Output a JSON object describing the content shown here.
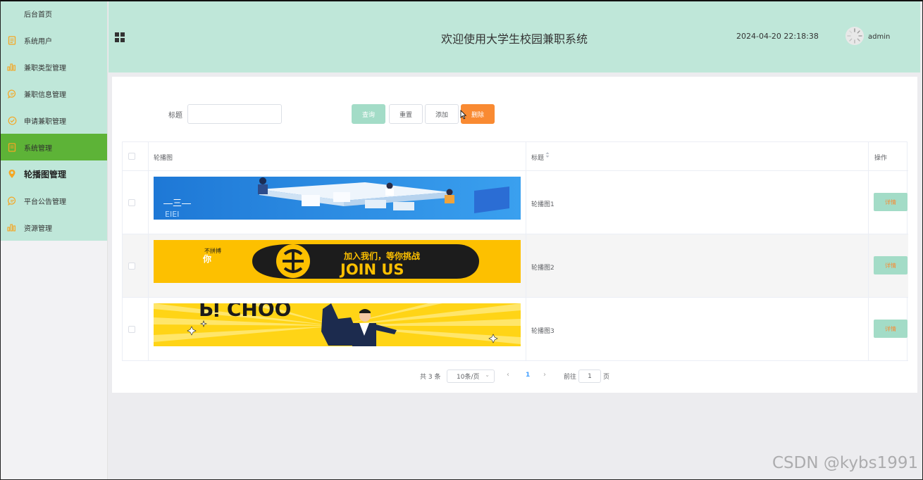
{
  "sidebar": {
    "items": [
      {
        "label": "后台首页",
        "icon": "none"
      },
      {
        "label": "系统用户",
        "icon": "document-icon"
      },
      {
        "label": "兼职类型管理",
        "icon": "bar-chart-icon"
      },
      {
        "label": "兼职信息管理",
        "icon": "chat-bubble-icon"
      },
      {
        "label": "申请兼职管理",
        "icon": "check-circle-icon"
      },
      {
        "label": "系统管理",
        "icon": "document-icon",
        "active": true
      },
      {
        "label": "轮播图管理",
        "icon": "location-pin-icon"
      },
      {
        "label": "平台公告管理",
        "icon": "chat-bubble-icon"
      },
      {
        "label": "资源管理",
        "icon": "bar-chart-icon"
      }
    ]
  },
  "header": {
    "title": "欢迎使用大学生校园兼职系统",
    "datetime": "2024-04-20 22:18:38",
    "username": "admin"
  },
  "search": {
    "label": "标题",
    "value": "",
    "buttons": {
      "query": "查询",
      "reset": "重置",
      "add": "添加",
      "delete": "删除"
    }
  },
  "table": {
    "headers": {
      "image": "轮播图",
      "title": "标题",
      "actions": "操作"
    },
    "rows": [
      {
        "title": "轮播图1",
        "action": "详情"
      },
      {
        "title": "轮播图2",
        "action": "详情",
        "banner_text_1": "加入我们，等你挑战",
        "banner_text_2": "JOIN US",
        "banner_text_3": "不拼搏",
        "banner_text_4": "你"
      },
      {
        "title": "轮播图3",
        "action": "详情"
      }
    ]
  },
  "pagination": {
    "total": "共 3 条",
    "page_size": "10条/页",
    "current": "1",
    "goto_label": "前往",
    "goto_value": "1",
    "page_suffix": "页"
  },
  "watermark": "CSDN @kybs1991",
  "colors": {
    "header_bg": "#bfe7d9",
    "active_menu": "#5db337",
    "primary_btn": "#a3dcc7",
    "danger_btn": "#f98a32",
    "icon_orange": "#f5a623"
  }
}
